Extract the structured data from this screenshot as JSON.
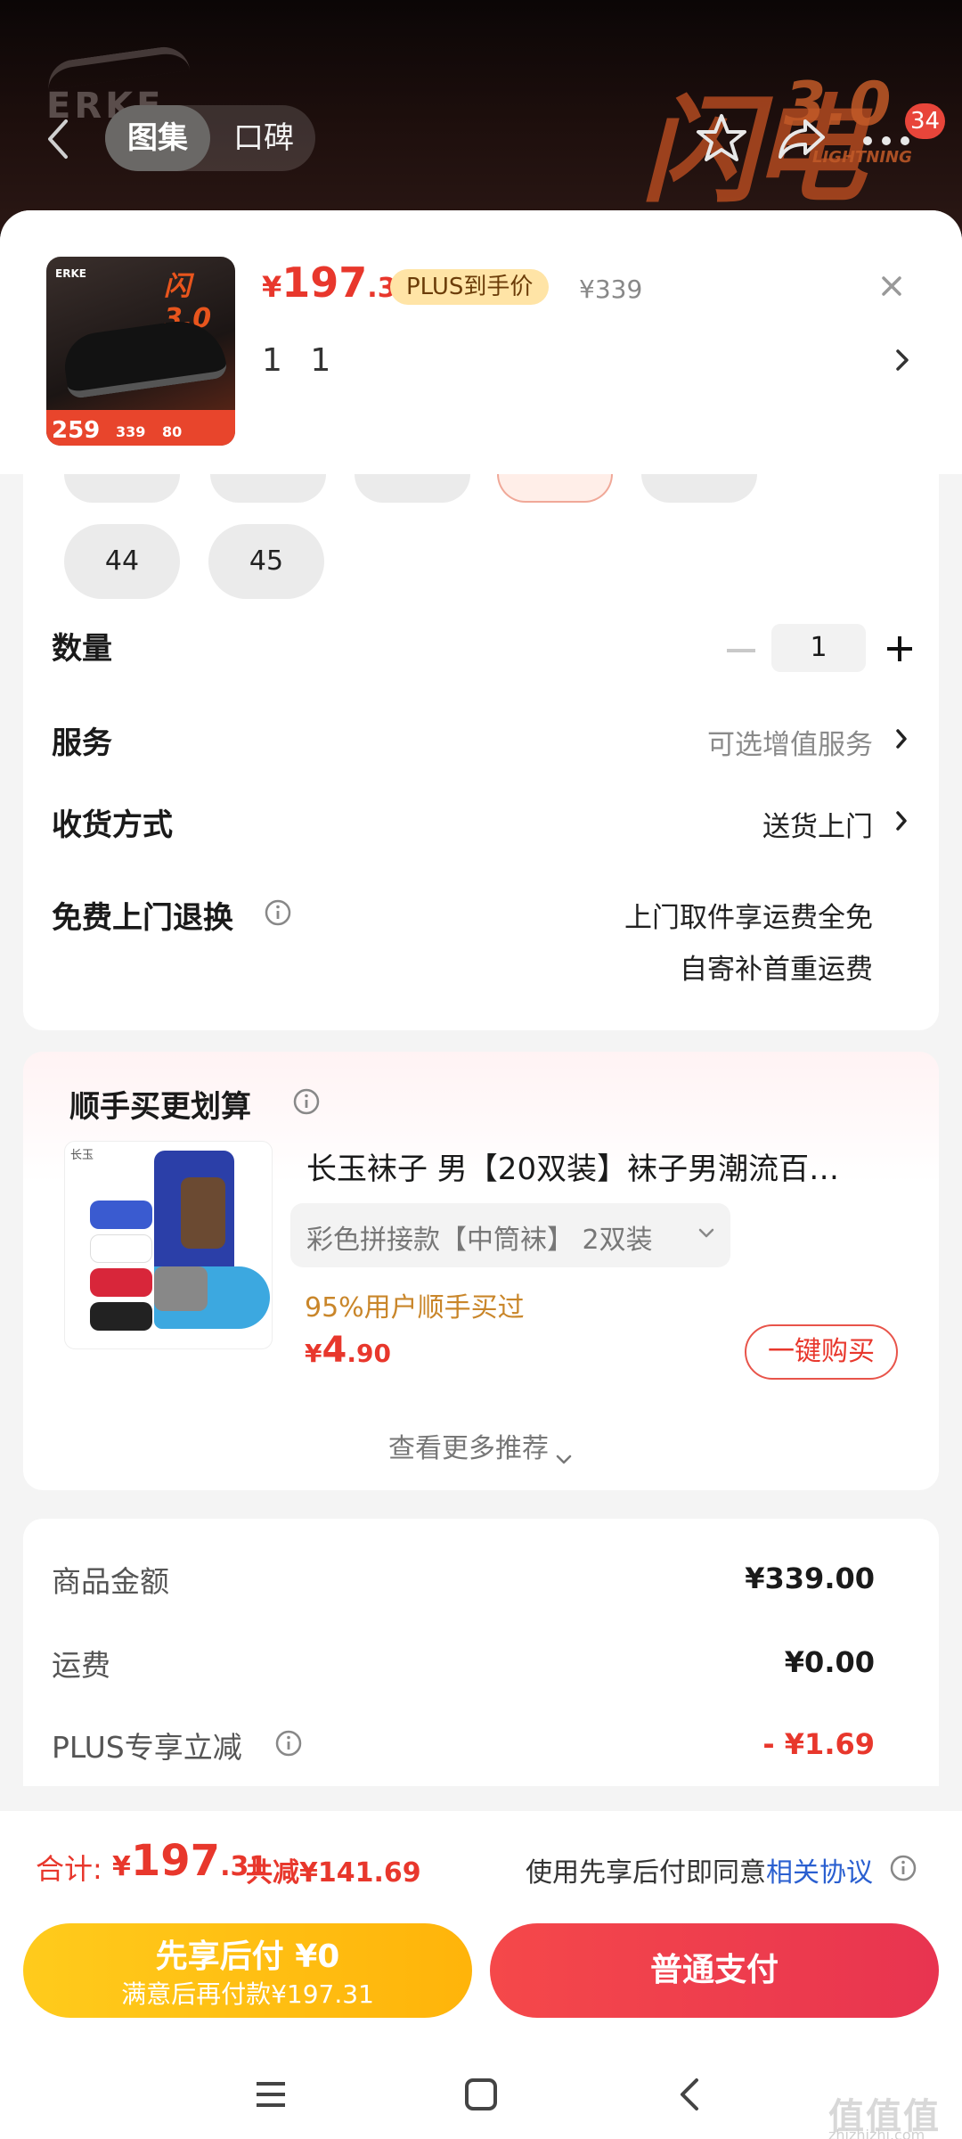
{
  "header": {
    "tabs": [
      {
        "label": "图集",
        "active": true
      },
      {
        "label": "口碑",
        "active": false
      }
    ],
    "badge_count": "34",
    "hero_brand": "ERKE",
    "hero_art": "闪电",
    "hero_version": "3.0",
    "hero_sub": "LIGHTNING"
  },
  "product": {
    "price_currency": "¥",
    "price_int": "197",
    "price_dec": ".31",
    "plus_tag": "PLUS到手价",
    "original_price": "¥339",
    "spec": "1 1",
    "thumb": {
      "brand": "ERKE",
      "art": "闪3.0",
      "p1": "259",
      "p2": "339",
      "p3": "80"
    }
  },
  "sizes": {
    "partial_row": [
      "",
      "",
      "",
      "",
      ""
    ],
    "full_row": [
      "44",
      "45"
    ]
  },
  "rows": {
    "quantity": {
      "label": "数量",
      "value": "1"
    },
    "service": {
      "label": "服务",
      "value": "可选增值服务"
    },
    "delivery": {
      "label": "收货方式",
      "value": "送货上门"
    },
    "return": {
      "label": "免费上门退换",
      "line1": "上门取件享运费全免",
      "line2": "自寄补首重运费"
    }
  },
  "addon": {
    "title": "顺手买更划算",
    "image_brand": "长玉",
    "name": "长玉袜子 男【20双装】袜子男潮流百…",
    "variant": "彩色拼接款【中筒袜】 2双装",
    "buyers": "95%用户顺手买过",
    "price_currency": "¥",
    "price_int": "4",
    "price_dec": ".90",
    "buy_label": "一键购买",
    "more_label": "查看更多推荐"
  },
  "summary": {
    "rows": [
      {
        "label": "商品金额",
        "value": "¥339.00",
        "red": false
      },
      {
        "label": "运费",
        "value": "¥0.00",
        "red": false
      },
      {
        "label": "PLUS专享立减",
        "value": "- ¥1.69",
        "red": true
      }
    ]
  },
  "bottom": {
    "total_label": "合计:",
    "total_currency": "¥",
    "total_int": "197",
    "total_dec": ".31",
    "total_save": "共减¥141.69",
    "agree_text": "使用先享后付即同意",
    "agree_link": "相关协议",
    "later_l1": "先享后付 ¥0",
    "later_l2": "满意后再付款¥197.31",
    "pay_label": "普通支付"
  },
  "watermark": {
    "main": "值值值",
    "sub": "zhizhizhi.com"
  },
  "colors": {
    "accent_red": "#e8372c",
    "plus_gold": "#ffe4a6",
    "later_yellow": "#ffb40a"
  }
}
